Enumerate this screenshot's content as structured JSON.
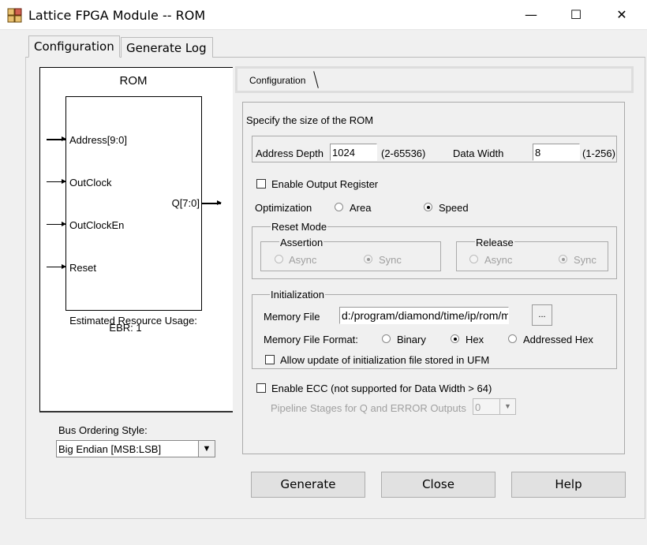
{
  "window": {
    "title": "Lattice FPGA Module -- ROM",
    "minimize": "—",
    "maximize": "☐",
    "close": "✕"
  },
  "tabs": [
    {
      "label": "Configuration",
      "active": true
    },
    {
      "label": "Generate Log",
      "active": false
    }
  ],
  "diagram": {
    "title": "ROM",
    "inputs": [
      "Address[9:0]",
      "OutClock",
      "OutClockEn",
      "Reset"
    ],
    "output": "Q[7:0]",
    "resource_line1": "Estimated Resource Usage:",
    "resource_line2": "EBR: 1"
  },
  "bus_ordering": {
    "label": "Bus Ordering Style:",
    "value": "Big Endian [MSB:LSB]"
  },
  "config": {
    "subtab": "Configuration",
    "size_heading": "Specify the size of the ROM",
    "address_depth": {
      "label": "Address Depth",
      "value": "1024",
      "range": "(2-65536)"
    },
    "data_width": {
      "label": "Data Width",
      "value": "8",
      "range": "(1-256)"
    },
    "enable_output_register": {
      "label": "Enable Output Register",
      "checked": false
    },
    "optimization": {
      "label": "Optimization",
      "options": [
        "Area",
        "Speed"
      ],
      "selected": "Speed"
    },
    "reset_mode": {
      "label": "Reset Mode",
      "assertion": {
        "label": "Assertion",
        "options": [
          "Async",
          "Sync"
        ],
        "selected": "Sync"
      },
      "release": {
        "label": "Release",
        "options": [
          "Async",
          "Sync"
        ],
        "selected": "Sync"
      }
    },
    "initialization": {
      "label": "Initialization",
      "memory_file_label": "Memory File",
      "memory_file": "d:/program/diamond/time/ip/rom/me",
      "browse": "...",
      "format_label": "Memory File Format:",
      "formats": [
        "Binary",
        "Hex",
        "Addressed Hex"
      ],
      "selected_format": "Hex",
      "allow_update": {
        "label": "Allow update of initialization file stored in UFM",
        "checked": false
      }
    },
    "enable_ecc": {
      "label": "Enable ECC (not supported for Data Width > 64)",
      "checked": false
    },
    "pipeline": {
      "label": "Pipeline Stages for Q and ERROR Outputs",
      "value": "0"
    }
  },
  "buttons": {
    "generate": "Generate",
    "close": "Close",
    "help": "Help"
  }
}
